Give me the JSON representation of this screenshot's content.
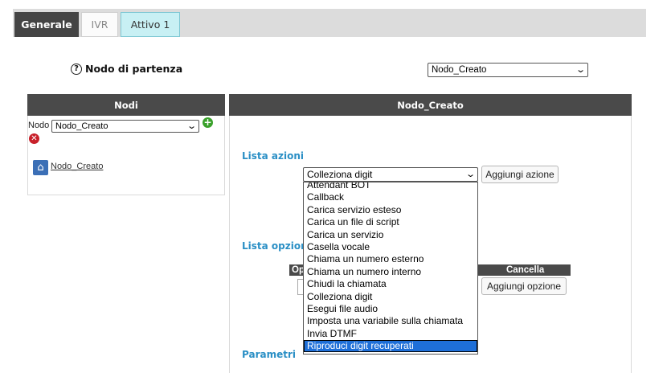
{
  "tabs": [
    {
      "label": "Generale"
    },
    {
      "label": "IVR"
    },
    {
      "label": "Attivo 1"
    }
  ],
  "start_node": {
    "label": "Nodo di partenza",
    "selected": "Nodo_Creato"
  },
  "left_panel": {
    "title": "Nodi",
    "nodo_label": "Nodo",
    "nodo_selected": "Nodo_Creato",
    "node_link": "Nodo_Creato"
  },
  "right_panel": {
    "title": "Nodo_Creato",
    "lista_azioni": "Lista azioni",
    "azione_selected": "Colleziona digit",
    "add_action": "Aggiungi azione",
    "lista_opzioni": "Lista opzioni",
    "option_header_first": "Op",
    "option_header_cancel": "Cancella",
    "add_option": "Aggiungi opzione",
    "parametri": "Parametri"
  },
  "dropdown_options": [
    "Attendant BOT",
    "Callback",
    "Carica servizio esteso",
    "Carica un file di script",
    "Carica un servizio",
    "Casella vocale",
    "Chiama un numero esterno",
    "Chiama un numero interno",
    "Chiudi la chiamata",
    "Colleziona digit",
    "Esegui file audio",
    "Imposta una variabile sulla chiamata",
    "Invia DTMF",
    "Riproduci digit recuperati"
  ],
  "dropdown_highlighted": "Riproduci digit recuperati",
  "icons": {
    "help": "question-circle-icon",
    "add": "plus-circle-icon",
    "delete": "x-circle-icon",
    "node": "home-icon"
  },
  "colors": {
    "accent_blue": "#2a8fc5",
    "header_dark": "#4a4a4a",
    "active_tab": "#c8f0f4",
    "highlight": "#1e6fd8"
  }
}
